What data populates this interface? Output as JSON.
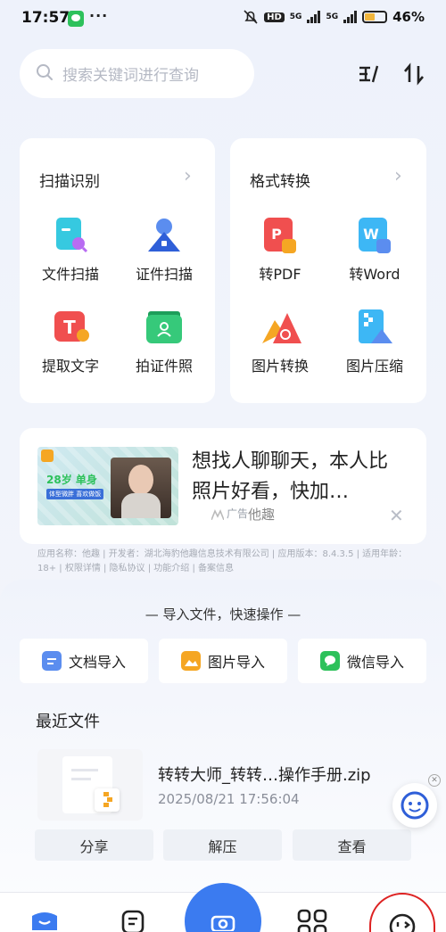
{
  "status_bar": {
    "time": "17:57",
    "dots": "···",
    "network_hd": "HD",
    "network_5g_1": "5G",
    "network_5g_2": "5G",
    "battery": "46%",
    "battery_level": 0.46,
    "wechat_icon": "wechat-icon",
    "mute_icon": "bell-off-icon"
  },
  "search": {
    "placeholder": "搜索关键词进行查询"
  },
  "toolbar": {
    "sort_icon": "sort-icon",
    "filter_icon": "swap-icon"
  },
  "scan_card": {
    "title": "扫描识别",
    "tools": [
      {
        "label": "文件扫描",
        "icon": "file-scan-icon"
      },
      {
        "label": "证件扫描",
        "icon": "id-scan-icon"
      },
      {
        "label": "提取文字",
        "icon": "text-extract-icon"
      },
      {
        "label": "拍证件照",
        "icon": "id-photo-icon"
      }
    ]
  },
  "convert_card": {
    "title": "格式转换",
    "tools": [
      {
        "label": "转PDF",
        "icon": "pdf-icon"
      },
      {
        "label": "转Word",
        "icon": "word-icon"
      },
      {
        "label": "图片转换",
        "icon": "image-convert-icon"
      },
      {
        "label": "图片压缩",
        "icon": "image-compress-icon"
      }
    ]
  },
  "ad": {
    "title": "想找人聊聊天，本人比照片好看，快加…",
    "badge": "广告",
    "source": "他趣",
    "img_text_1": "28岁 单身",
    "img_text_2": "体型微胖 喜欢做饭",
    "info": "应用名称：他趣 | 开发者：湖北海豹他趣信息技术有限公司 | 应用版本：8.4.3.5 | 适用年龄：18+ | 权限详情 | 隐私协议 | 功能介绍 | 备案信息"
  },
  "import": {
    "header": "— 导入文件，快速操作 —",
    "buttons": [
      {
        "label": "文档导入",
        "color": "#5b8def"
      },
      {
        "label": "图片导入",
        "color": "#f5a623"
      },
      {
        "label": "微信导入",
        "color": "#2dc15b"
      }
    ]
  },
  "recent": {
    "title": "最近文件",
    "file_name": "转转大师_转转…操作手册.zip",
    "file_date": "2025/08/21 17:56:04",
    "actions": [
      "分享",
      "解压",
      "查看"
    ]
  },
  "colors": {
    "accent": "#3b7bf0"
  }
}
